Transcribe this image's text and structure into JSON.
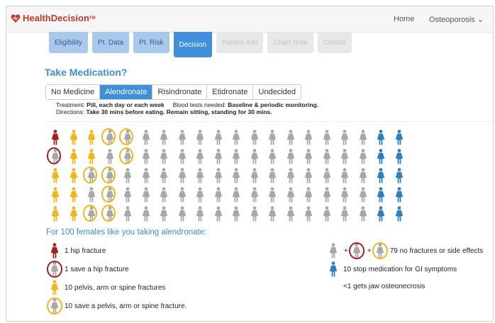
{
  "app": {
    "brand": "HealthDecision",
    "brand_tm": "TM",
    "nav_links": [
      "Home",
      "Osteoporosis ⌄"
    ]
  },
  "tabs": [
    {
      "label": "Eligibility",
      "state": "past"
    },
    {
      "label": "Pt. Data",
      "state": "past"
    },
    {
      "label": "Pt. Risk",
      "state": "past"
    },
    {
      "label": "Decision",
      "state": "active"
    },
    {
      "label": "Patient Info",
      "state": "future"
    },
    {
      "label": "Chart Note",
      "state": "future"
    },
    {
      "label": "Credits",
      "state": "future"
    }
  ],
  "heading": "Take Medication?",
  "medications": [
    {
      "label": "No Medicine",
      "selected": false
    },
    {
      "label": "Alendronate",
      "selected": true
    },
    {
      "label": "Risindronate",
      "selected": false
    },
    {
      "label": "Etidronate",
      "selected": false
    },
    {
      "label": "Undecided",
      "selected": false
    }
  ],
  "details": {
    "treatment_label": "Treatment:",
    "treatment_value": "Pill, each day or each week",
    "blood_label": "Blood tests needed:",
    "blood_value": "Baseline & periodic monitoring.",
    "directions_label": "Directions:",
    "directions_value": "Take 30 mins before eating. Remain sitting, standing for 30 mins."
  },
  "colors": {
    "hip": "#a51d1d",
    "fracture": "#f3b619",
    "neutral": "#a8a8a8",
    "stop": "#2c7fc1",
    "accent": "#3a8ed6"
  },
  "pictogram": {
    "columns": [
      [
        "hip",
        "save-hip",
        "fracture",
        "fracture",
        "fracture"
      ],
      [
        "fracture",
        "fracture",
        "fracture",
        "fracture",
        "fracture"
      ],
      [
        "fracture",
        "fracture",
        "save-fracture",
        "neutral",
        "save-fracture"
      ],
      [
        "save-fracture",
        "neutral",
        "save-fracture",
        "save-fracture",
        "save-fracture"
      ],
      [
        "save-fracture",
        "save-fracture",
        "neutral",
        "neutral",
        "neutral"
      ],
      [
        "neutral",
        "neutral",
        "neutral",
        "neutral",
        "neutral"
      ],
      [
        "neutral",
        "neutral",
        "neutral",
        "neutral",
        "neutral"
      ],
      [
        "neutral",
        "neutral",
        "neutral",
        "neutral",
        "neutral"
      ],
      [
        "neutral",
        "neutral",
        "neutral",
        "neutral",
        "neutral"
      ],
      [
        "neutral",
        "neutral",
        "neutral",
        "neutral",
        "neutral"
      ],
      [
        "neutral",
        "neutral",
        "neutral",
        "neutral",
        "neutral"
      ],
      [
        "neutral",
        "neutral",
        "neutral",
        "neutral",
        "neutral"
      ],
      [
        "neutral",
        "neutral",
        "neutral",
        "neutral",
        "neutral"
      ],
      [
        "neutral",
        "neutral",
        "neutral",
        "neutral",
        "neutral"
      ],
      [
        "neutral",
        "neutral",
        "neutral",
        "neutral",
        "neutral"
      ],
      [
        "neutral",
        "neutral",
        "neutral",
        "neutral",
        "neutral"
      ],
      [
        "neutral",
        "neutral",
        "neutral",
        "neutral",
        "neutral"
      ],
      [
        "neutral",
        "neutral",
        "neutral",
        "neutral",
        "neutral"
      ],
      [
        "stop",
        "stop",
        "stop",
        "stop",
        "stop"
      ],
      [
        "stop",
        "stop",
        "stop",
        "stop",
        "stop"
      ]
    ]
  },
  "summary": "For 100 females like you taking alendronate:",
  "legend": {
    "hip": "1 hip fracture",
    "save_hip": "1 save a hip fracture",
    "fracture": "10 pelvis, arm or spine fractures",
    "save_fracture": "10 save a pelvis, arm or spine fracture.",
    "neutral": "79 no fractures or side effects",
    "stop": "10 stop medication for GI symptoms",
    "jaw": "<1 gets jaw osteonecrosis",
    "plus": "+"
  }
}
